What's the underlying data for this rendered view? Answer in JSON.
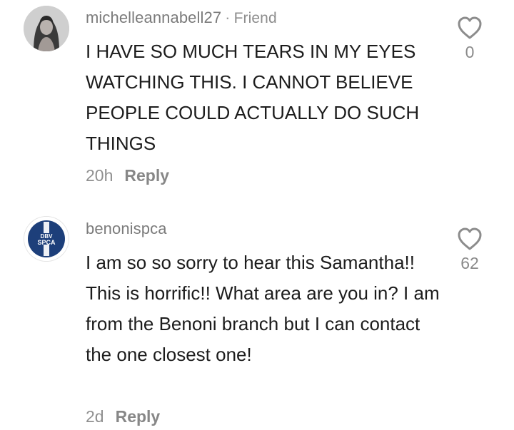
{
  "comments": [
    {
      "username": "michelleannabell27",
      "separator": "·",
      "badge": "Friend",
      "text": "I HAVE SO MUCH TEARS IN MY EYES WATCHING THIS. I CANNOT BELIEVE PEOPLE COULD ACTUALLY DO SUCH THINGS",
      "time": "20h",
      "reply_label": "Reply",
      "likes": "0",
      "avatar_icon": "user-photo-avatar"
    },
    {
      "username": "benonispca",
      "text": "I am so so sorry to hear this Samantha!! This is horrific!! What area are you in? I am from the Benoni branch but I can contact the one closest one!",
      "time": "2d",
      "reply_label": "Reply",
      "likes": "62",
      "avatar_icon": "spca-logo-avatar",
      "avatar_logo_text": [
        "DBV",
        "SPCA"
      ]
    }
  ],
  "colors": {
    "text": "#1c1c1c",
    "muted": "#8f8f8f",
    "logo_blue": "#1d3f7a"
  }
}
